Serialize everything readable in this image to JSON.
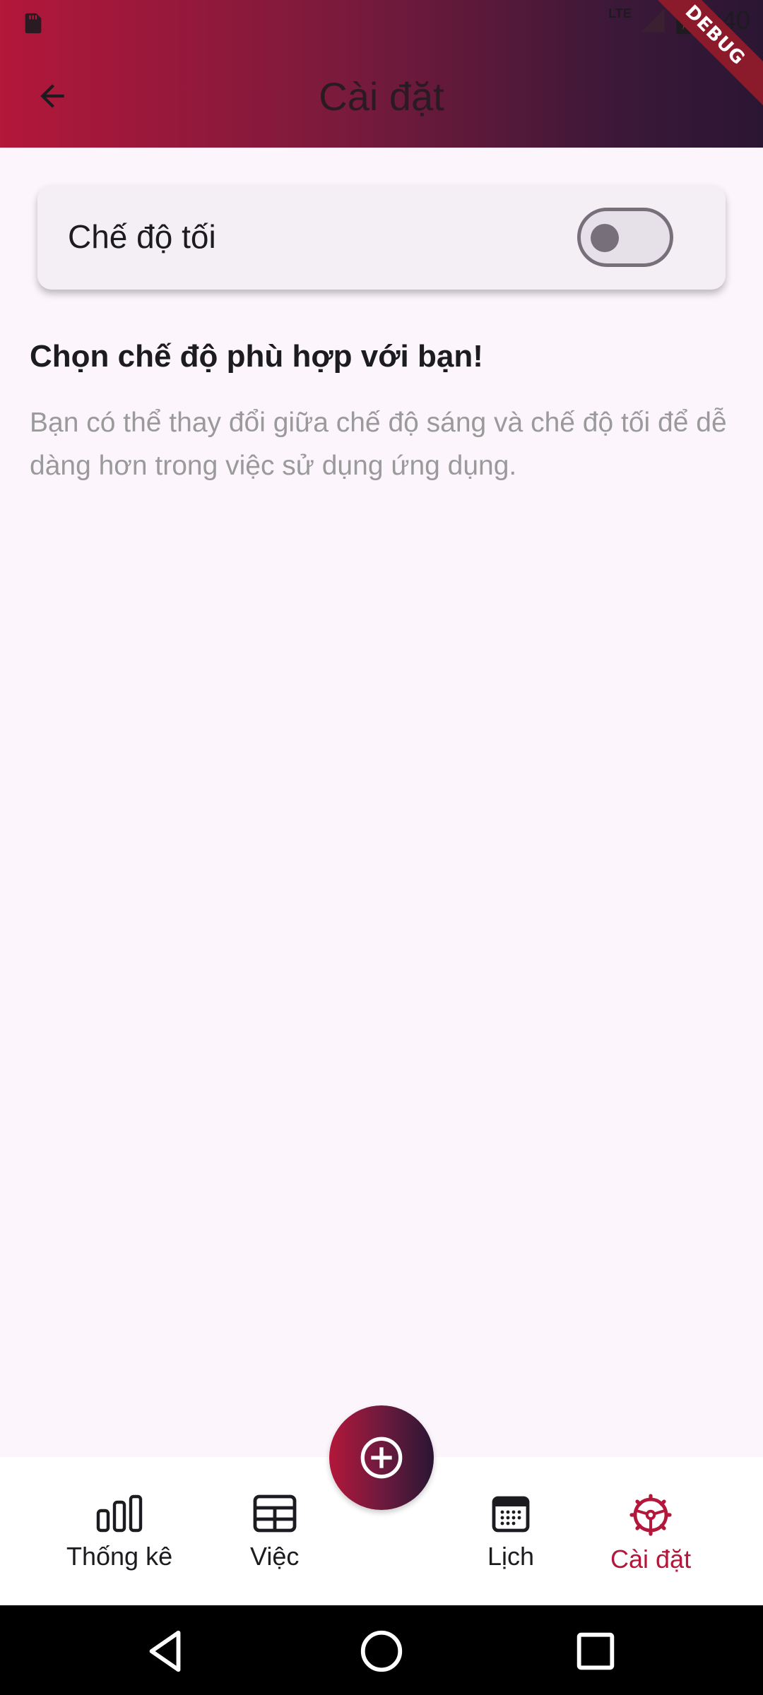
{
  "status_bar": {
    "network": "LTE",
    "time": "3:40",
    "debug_label": "DEBUG"
  },
  "appbar": {
    "title": "Cài đặt",
    "back_icon": "arrow-left-icon"
  },
  "settings": {
    "dark_mode_label": "Chế độ tối",
    "dark_mode_enabled": false,
    "heading": "Chọn chế độ phù hợp với bạn!",
    "description": "Bạn có thể thay đổi giữa chế độ sáng và chế độ tối để dễ dàng hơn trong việc sử dụng ứng dụng."
  },
  "bottom_nav": {
    "items": [
      {
        "label": "Thống kê",
        "icon": "bar-chart-icon"
      },
      {
        "label": "Việc",
        "icon": "table-icon"
      },
      {
        "label": "Lịch",
        "icon": "calendar-icon"
      },
      {
        "label": "Cài đặt",
        "icon": "steering-wheel-icon",
        "active": true
      }
    ],
    "fab_icon": "add-circle-icon"
  },
  "colors": {
    "accent": "#b3173a",
    "gradient_end": "#2a1633",
    "background": "#fcf6fc"
  }
}
